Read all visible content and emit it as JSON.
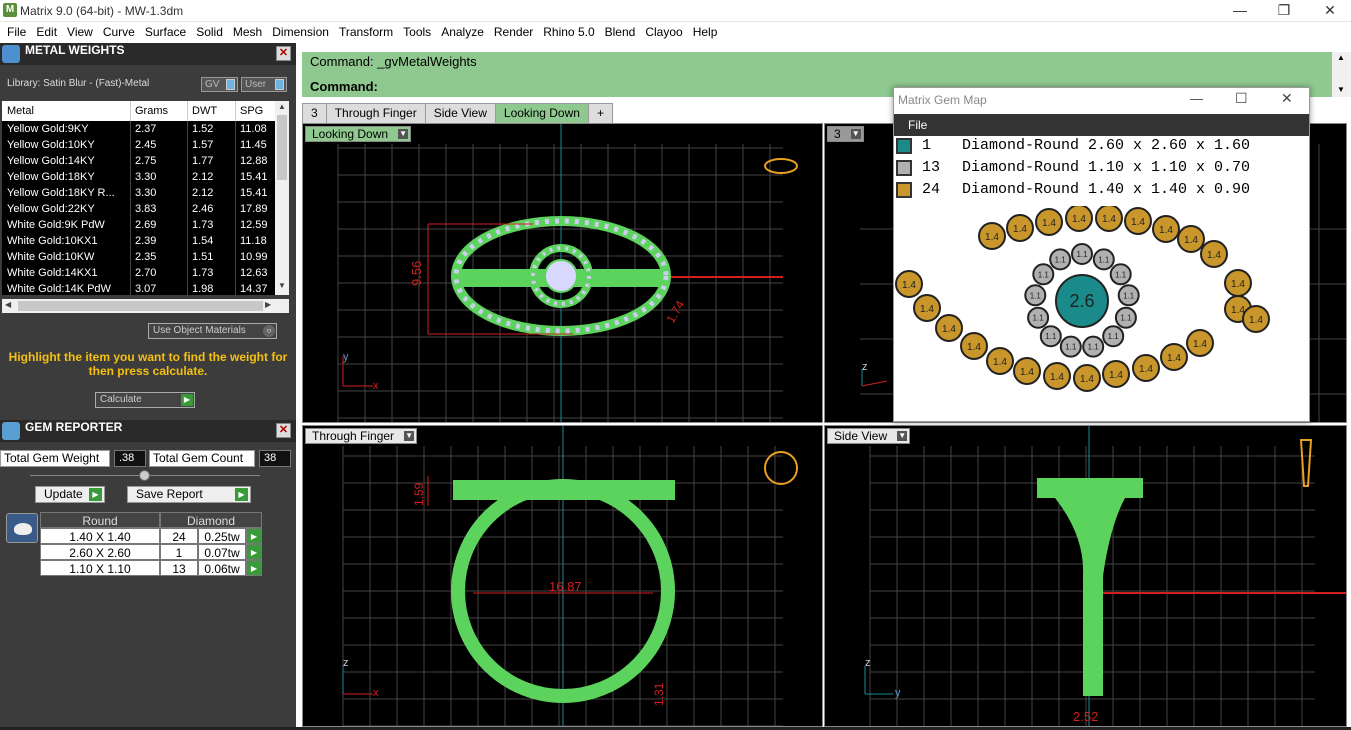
{
  "window": {
    "title": "Matrix 9.0 (64-bit) - MW-1.3dm",
    "logo": "M"
  },
  "menu": [
    "File",
    "Edit",
    "View",
    "Curve",
    "Surface",
    "Solid",
    "Mesh",
    "Dimension",
    "Transform",
    "Tools",
    "Analyze",
    "Render",
    "Rhino 5.0",
    "Blend",
    "Clayoo",
    "Help"
  ],
  "metal_weights": {
    "title": "METAL WEIGHTS",
    "library": "Library: Satin Blur - (Fast)-Metal",
    "gv": "GV",
    "user": "User",
    "headers": [
      "Metal",
      "Grams",
      "DWT",
      "SPG"
    ],
    "rows": [
      [
        "Yellow Gold:9KY",
        "2.37",
        "1.52",
        "11.08"
      ],
      [
        "Yellow Gold:10KY",
        "2.45",
        "1.57",
        "11.45"
      ],
      [
        "Yellow Gold:14KY",
        "2.75",
        "1.77",
        "12.88"
      ],
      [
        "Yellow Gold:18KY",
        "3.30",
        "2.12",
        "15.41"
      ],
      [
        "Yellow Gold:18KY R...",
        "3.30",
        "2.12",
        "15.41"
      ],
      [
        "Yellow Gold:22KY",
        "3.83",
        "2.46",
        "17.89"
      ],
      [
        "White Gold:9K PdW",
        "2.69",
        "1.73",
        "12.59"
      ],
      [
        "White Gold:10KX1",
        "2.39",
        "1.54",
        "11.18"
      ],
      [
        "White Gold:10KW",
        "2.35",
        "1.51",
        "10.99"
      ],
      [
        "White Gold:14KX1",
        "2.70",
        "1.73",
        "12.63"
      ],
      [
        "White Gold:14K PdW",
        "3.07",
        "1.98",
        "14.37"
      ]
    ],
    "use_object_materials": "Use Object Materials",
    "hint": "Highlight the item you want to find the weight for then press calculate.",
    "calculate": "Calculate"
  },
  "gem_reporter": {
    "title": "GEM REPORTER",
    "total_weight_label": "Total Gem Weight",
    "total_weight": ".38",
    "total_count_label": "Total Gem Count",
    "total_count": "38",
    "update": "Update",
    "save_report": "Save Report",
    "col_shape": "Round",
    "col_type": "Diamond",
    "rows": [
      [
        "1.40 X 1.40",
        "24",
        "0.25tw"
      ],
      [
        "2.60 X 2.60",
        "1",
        "0.07tw"
      ],
      [
        "1.10 X 1.10",
        "13",
        "0.06tw"
      ]
    ]
  },
  "command": {
    "line1": "Command: _gvMetalWeights",
    "line2": "Command:"
  },
  "tabs": [
    "3",
    "Through Finger",
    "Side View",
    "Looking Down",
    "+"
  ],
  "viewports": {
    "top_left": {
      "label": "Looking Down",
      "dims": [
        "9.56",
        "1.74"
      ],
      "axes": [
        "y",
        "x"
      ]
    },
    "top_right": {
      "label": "3",
      "axes": [
        "z"
      ]
    },
    "bottom_left": {
      "label": "Through Finger",
      "dims": [
        "1.59",
        "16.87",
        "1.31"
      ],
      "axes": [
        "z",
        "x"
      ]
    },
    "bottom_right": {
      "label": "Side View",
      "dims": [
        "2.52"
      ],
      "axes": [
        "z",
        "y"
      ]
    }
  },
  "gem_map": {
    "title": "Matrix Gem Map",
    "menu_file": "File",
    "legend": [
      {
        "count": "1",
        "desc": "Diamond-Round 2.60 x 2.60 x 1.60",
        "color": "#1a8a8a"
      },
      {
        "count": "13",
        "desc": "Diamond-Round 1.10 x 1.10 x 0.70",
        "color": "#b0b0b0"
      },
      {
        "count": "24",
        "desc": "Diamond-Round 1.40 x 1.40 x 0.90",
        "color": "#c8962a"
      }
    ],
    "center_label": "2.6",
    "small_label": "1.1",
    "outer_label": "1.4"
  },
  "colors": {
    "accent_green": "#8fc98f",
    "model_green": "#5cd35c",
    "dim_red": "#d02020"
  }
}
